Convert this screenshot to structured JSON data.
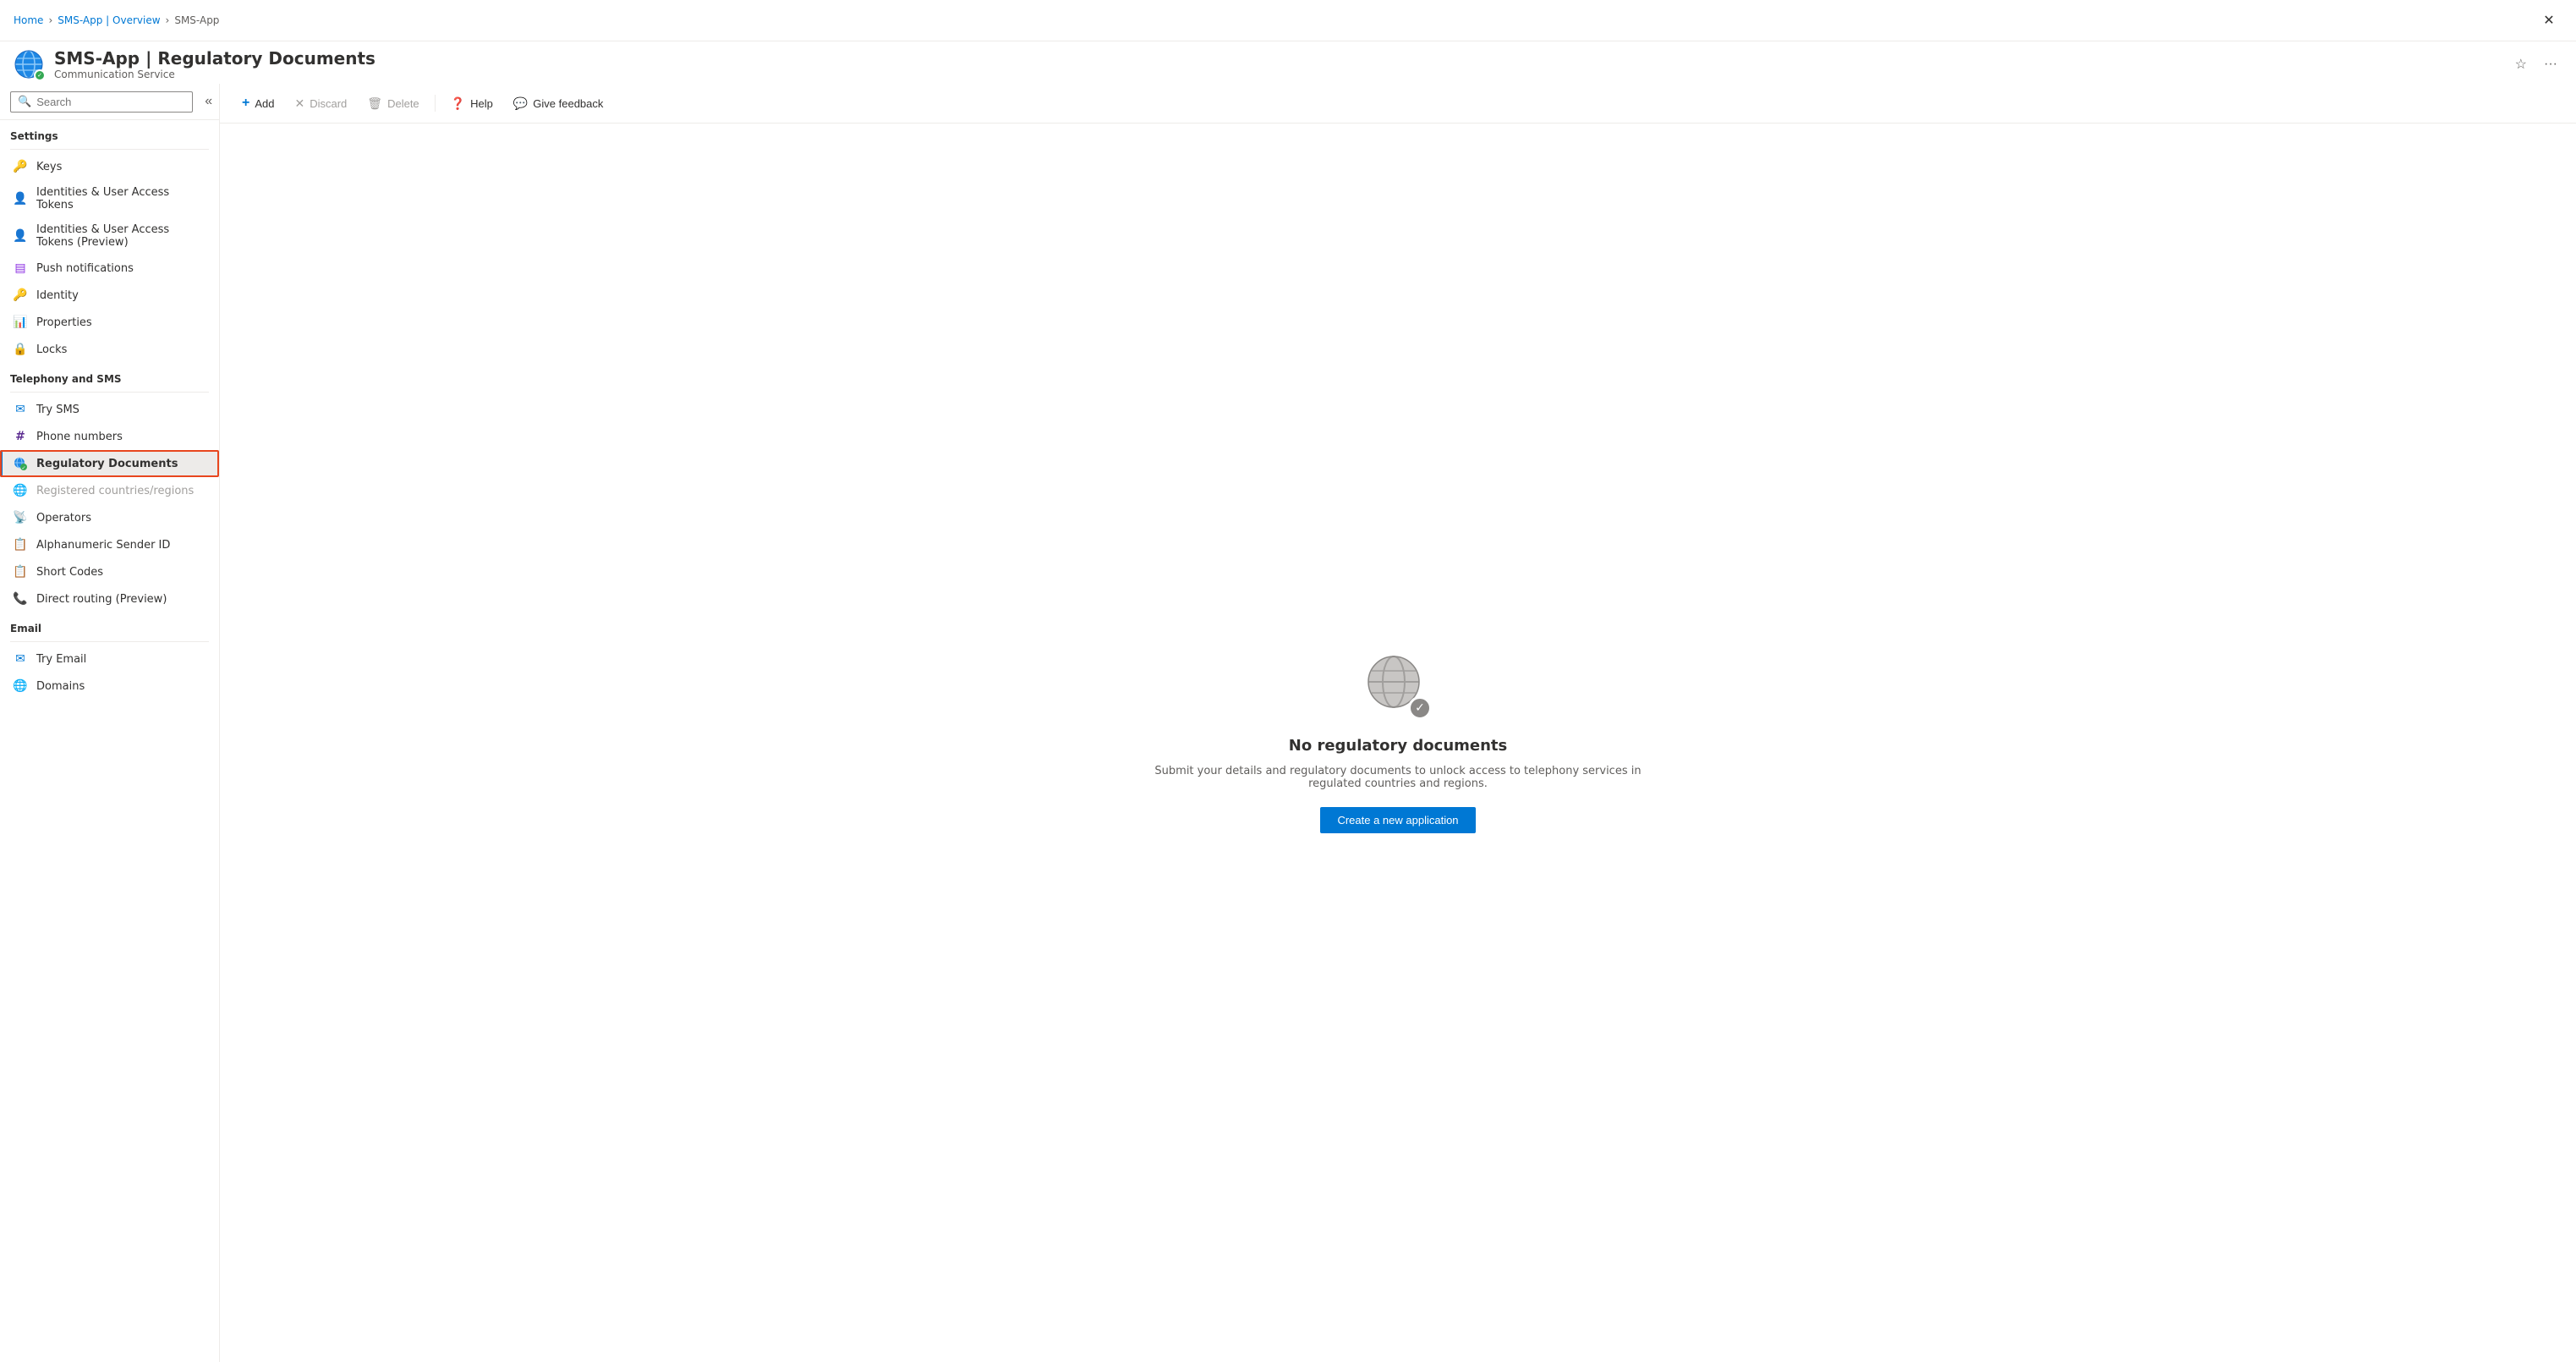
{
  "breadcrumb": {
    "items": [
      "Home",
      "SMS-App | Overview",
      "SMS-App"
    ],
    "separators": [
      ">",
      ">"
    ]
  },
  "app": {
    "title": "SMS-App | Regulatory Documents",
    "subtitle": "Communication Service",
    "star_label": "Favorite",
    "more_label": "More"
  },
  "sidebar": {
    "search_placeholder": "Search",
    "search_label": "Search",
    "collapse_label": "Collapse",
    "settings_label": "Settings",
    "items_settings": [
      {
        "id": "keys",
        "label": "Keys",
        "icon": "🔑"
      },
      {
        "id": "identities1",
        "label": "Identities & User Access Tokens",
        "icon": "👤"
      },
      {
        "id": "identities2",
        "label": "Identities & User Access Tokens (Preview)",
        "icon": "👤"
      },
      {
        "id": "push",
        "label": "Push notifications",
        "icon": "📋"
      },
      {
        "id": "identity",
        "label": "Identity",
        "icon": "🔑"
      },
      {
        "id": "properties",
        "label": "Properties",
        "icon": "📊"
      },
      {
        "id": "locks",
        "label": "Locks",
        "icon": "🔒"
      }
    ],
    "telephony_label": "Telephony and SMS",
    "items_telephony": [
      {
        "id": "try-sms",
        "label": "Try SMS",
        "icon": "✉"
      },
      {
        "id": "phone-numbers",
        "label": "Phone numbers",
        "icon": "#"
      },
      {
        "id": "regulatory-docs",
        "label": "Regulatory Documents",
        "icon": "🌐",
        "active": true
      },
      {
        "id": "registered-countries",
        "label": "Registered countries/regions",
        "icon": "🌐",
        "disabled": true
      },
      {
        "id": "operators",
        "label": "Operators",
        "icon": "📡"
      },
      {
        "id": "alphanumeric",
        "label": "Alphanumeric Sender ID",
        "icon": "📋"
      },
      {
        "id": "short-codes",
        "label": "Short Codes",
        "icon": "📋"
      },
      {
        "id": "direct-routing",
        "label": "Direct routing (Preview)",
        "icon": "📞"
      }
    ],
    "email_label": "Email",
    "items_email": [
      {
        "id": "try-email",
        "label": "Try Email",
        "icon": "✉"
      },
      {
        "id": "domains",
        "label": "Domains",
        "icon": "🌐"
      }
    ]
  },
  "toolbar": {
    "add_label": "Add",
    "discard_label": "Discard",
    "delete_label": "Delete",
    "help_label": "Help",
    "feedback_label": "Give feedback"
  },
  "empty_state": {
    "title": "No regulatory documents",
    "description": "Submit your details and regulatory documents to unlock access to telephony services in regulated countries and regions.",
    "create_button": "Create a new application"
  },
  "close_label": "Close"
}
